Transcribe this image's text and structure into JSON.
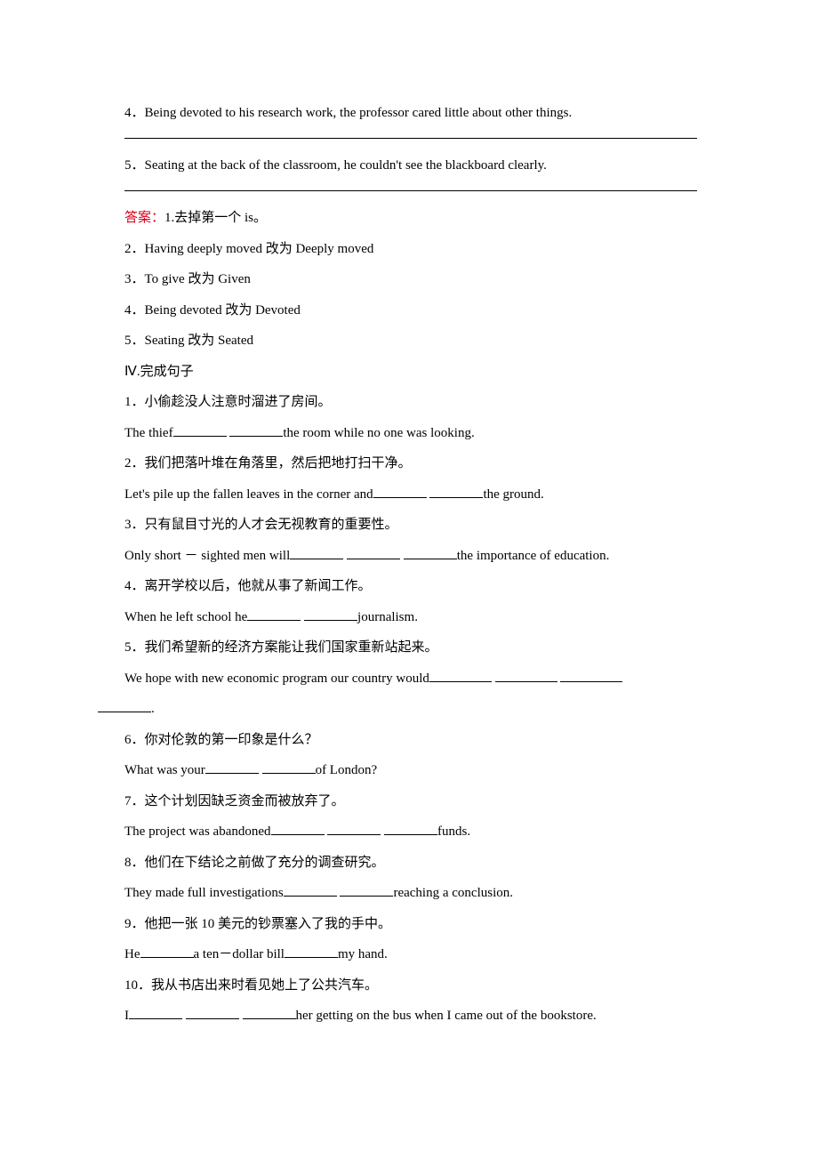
{
  "q4": "4．Being devoted to his research work, the professor cared little about other things.",
  "q5": "5．Seating at the back of the classroom, he couldn't see the blackboard clearly.",
  "answers_label": "答案：",
  "a1": "1.去掉第一个 is。",
  "a2": "2．Having deeply moved 改为 Deeply moved",
  "a3": "3．To give 改为 Given",
  "a4": "4．Being devoted 改为 Devoted",
  "a5": "5．Seating 改为 Seated",
  "section4": "Ⅳ.完成句子",
  "s1cn": "1．小偷趁没人注意时溜进了房间。",
  "s1a": "The thief",
  "s1b": "the room while no one was looking.",
  "s2cn": "2．我们把落叶堆在角落里，然后把地打扫干净。",
  "s2a": "Let's pile up the fallen leaves in the corner and",
  "s2b": "the ground.",
  "s3cn": "3．只有鼠目寸光的人才会无视教育的重要性。",
  "s3a": "Only short － sighted men will",
  "s3b": "the importance of education.",
  "s4cn": "4．离开学校以后，他就从事了新闻工作。",
  "s4a": "When he left school he",
  "s4b": "journalism.",
  "s5cn": "5．我们希望新的经济方案能让我们国家重新站起来。",
  "s5a": "We hope with new economic program our country would",
  "s5b": ".",
  "s6cn": "6．你对伦敦的第一印象是什么？",
  "s6a": "What was your",
  "s6b": "of London?",
  "s7cn": "7．这个计划因缺乏资金而被放弃了。",
  "s7a": "The project was abandoned",
  "s7b": "funds.",
  "s8cn": "8．他们在下结论之前做了充分的调查研究。",
  "s8a": "They made full investigations",
  "s8b": "reaching a conclusion.",
  "s9cn": "9．他把一张 10 美元的钞票塞入了我的手中。",
  "s9a": "He",
  "s9b": "a ten－dollar bill",
  "s9c": "my hand.",
  "s10cn": "10．我从书店出来时看见她上了公共汽车。",
  "s10a": "I",
  "s10b": "her getting on the bus when I came out of the bookstore."
}
